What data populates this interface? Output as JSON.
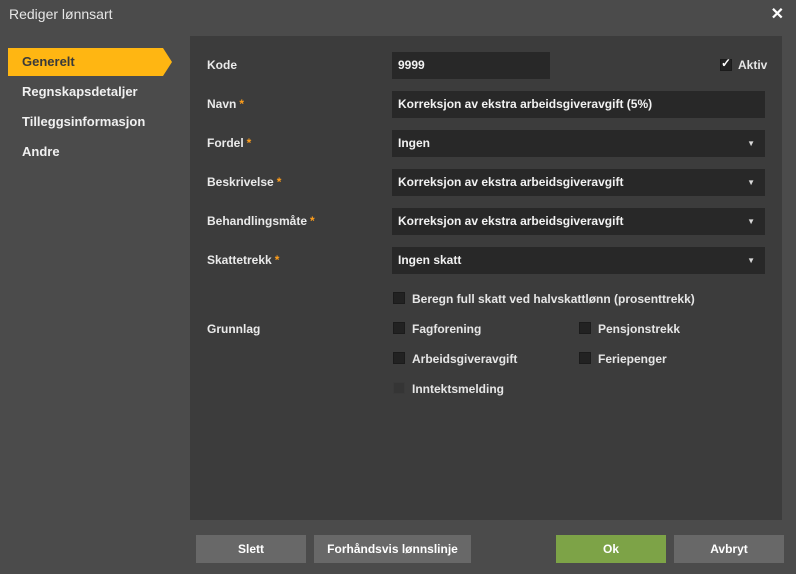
{
  "dialog": {
    "title": "Rediger lønnsart",
    "close_glyph": "✕"
  },
  "sidebar": {
    "items": [
      {
        "label": "Generelt",
        "active": true
      },
      {
        "label": "Regnskapsdetaljer"
      },
      {
        "label": "Tilleggsinformasjon"
      },
      {
        "label": "Andre"
      }
    ]
  },
  "form": {
    "kode": {
      "label": "Kode",
      "value": "9999"
    },
    "aktiv": {
      "label": "Aktiv",
      "checked": true
    },
    "navn": {
      "label": "Navn",
      "required": "*",
      "value": "Korreksjon av ekstra arbeidsgiveravgift (5%)"
    },
    "fordel": {
      "label": "Fordel",
      "required": "*",
      "value": "Ingen"
    },
    "beskrivelse": {
      "label": "Beskrivelse",
      "required": "*",
      "value": "Korreksjon av ekstra arbeidsgiveravgift"
    },
    "behandlingsmate": {
      "label": "Behandlingsmåte",
      "required": "*",
      "value": "Korreksjon av ekstra arbeidsgiveravgift"
    },
    "skattetrekk": {
      "label": "Skattetrekk",
      "required": "*",
      "value": "Ingen skatt"
    },
    "beregn_full_skatt": {
      "label": "Beregn full skatt ved halvskattlønn (prosenttrekk)",
      "checked": false
    },
    "grunnlag": {
      "label": "Grunnlag",
      "fagforening": "Fagforening",
      "pensjonstrekk": "Pensjonstrekk",
      "arbeidsgiveravgift": "Arbeidsgiveravgift",
      "feriepenger": "Feriepenger",
      "inntektsmelding": "Inntektsmelding"
    },
    "dropdown_icon": "▼"
  },
  "footer": {
    "slett": "Slett",
    "forhandsvis": "Forhåndsvis lønnslinje",
    "ok": "Ok",
    "avbryt": "Avbryt"
  },
  "colors": {
    "accent": "#ffb612",
    "ok_button": "#7da347",
    "required": "#ff9e1b"
  }
}
